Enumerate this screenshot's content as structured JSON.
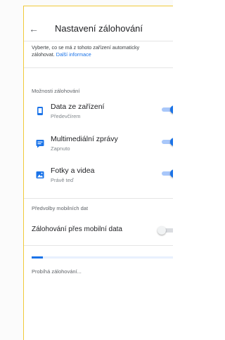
{
  "header": {
    "back_icon": "arrow-back-icon",
    "title": "Nastavení zálohování"
  },
  "description": {
    "text_line1": "Vyberte, co se má z tohoto zařízení automaticky",
    "text_line2": "zálohovat.",
    "link": "Další informace"
  },
  "backup_options": {
    "section_title": "Možnosti zálohování",
    "items": [
      {
        "icon": "phone-icon",
        "title": "Data ze zařízení",
        "subtitle": "Předevčírem",
        "enabled": true
      },
      {
        "icon": "sms-icon",
        "title": "Multimediální zprávy",
        "subtitle": "Zapnuto",
        "enabled": true
      },
      {
        "icon": "photo-icon",
        "title": "Fotky a videa",
        "subtitle": "Právě teď",
        "enabled": true
      }
    ]
  },
  "mobile_data": {
    "section_title": "Předvolby mobilních dat",
    "label": "Zálohování přes mobilní data",
    "enabled": false
  },
  "progress": {
    "fraction": 0.08,
    "status": "Probíhá zálohování..."
  },
  "colors": {
    "accent": "#1a73e8",
    "frame_border": "#f0c93a"
  }
}
